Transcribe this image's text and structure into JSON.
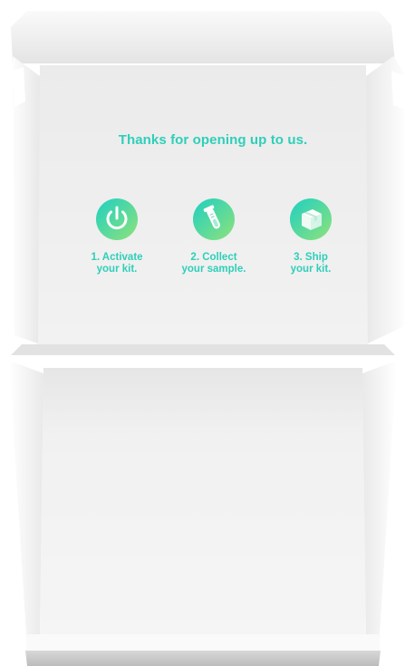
{
  "headline": "Thanks for opening up to us.",
  "steps": [
    {
      "label": "1. Activate\nyour kit.",
      "icon": "power-icon"
    },
    {
      "label": "2. Collect\nyour sample.",
      "icon": "test-tube-icon"
    },
    {
      "label": "3. Ship\nyour kit.",
      "icon": "package-icon"
    }
  ],
  "colors": {
    "accent": "#2ecfb9",
    "gradient_top": "#1ed0c2",
    "gradient_bottom": "#8fe27a",
    "lid_interior": "#eeeeee",
    "box_white": "#f7f7f7"
  }
}
